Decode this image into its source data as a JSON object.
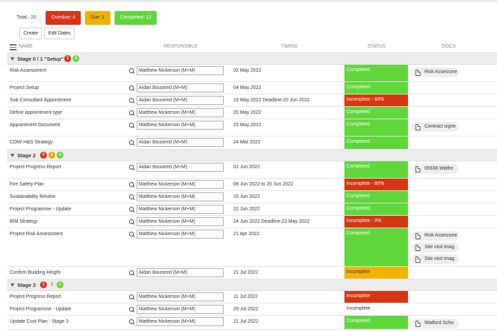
{
  "summary": {
    "total": "Total.: 20",
    "overdue": "Overdue: 4",
    "due": "Due: 1",
    "completed": "Completed: 12"
  },
  "actions": {
    "create": "Create",
    "edit_dates": "Edit Dates"
  },
  "columns": {
    "name": "NAME",
    "responsible": "RESPONSIBLE",
    "timing": "TIMING",
    "status": "STATUS",
    "docs": "DOCS"
  },
  "stages": [
    {
      "label": "Stage 0 / 1 \"Setup\"",
      "badges": [
        "1",
        "5"
      ]
    },
    {
      "label": "Stage 2",
      "badges": [
        "2",
        "1",
        "4"
      ]
    },
    {
      "label": "Stage 3",
      "badges": [
        "1",
        "1",
        "1"
      ]
    }
  ],
  "rows": [
    {
      "name": "Risk Assessment",
      "responsible": "Matthew Nickerson (M+M)",
      "timing": "02 May 2022",
      "status": "Completed",
      "docs": [
        "Risk Assessme"
      ]
    },
    {
      "name": "Project Setup",
      "responsible": "Aidan Boustred (M+M)",
      "timing": "04 May 2022",
      "status": "Completed",
      "docs": []
    },
    {
      "name": "Sub Consultant Appointment",
      "responsible": "Aidan Boustred (M+M)",
      "timing": "19 May 2022 Deadline:20 Jun 2022",
      "status": "Incomplete - 60%",
      "docs": []
    },
    {
      "name": "Define appointment type",
      "responsible": "Matthew Nickerson (M+M)",
      "timing": "20 May 2022",
      "status": "Completed",
      "docs": []
    },
    {
      "name": "Appointment Document",
      "responsible": "Matthew Nickerson (M+M)",
      "timing": "23 May 2022",
      "status": "Completed",
      "docs": [
        "Contract signe"
      ]
    },
    {
      "name": "CDM/ H&S Strategy",
      "responsible": "Aidan Boustred (M+M)",
      "timing": "24 Mar 2022",
      "status": "Completed",
      "docs": []
    },
    {
      "name": "Project Progress Report",
      "responsible": "Aidan Boustred (M+M)",
      "timing": "01 Jun 2022",
      "status": "Completed",
      "docs": [
        "05936 Watfor"
      ]
    },
    {
      "name": "Fire Safety Plan",
      "responsible": "Matthew Nickerson (M+M)",
      "timing": "08 Jun 2022 to 20 Jun 2022",
      "status": "Incomplete - 80%",
      "docs": []
    },
    {
      "name": "Sustainability Review",
      "responsible": "Matthew Nickerson (M+M)",
      "timing": "15 Jun 2022",
      "status": "Completed",
      "docs": []
    },
    {
      "name": "Project Programme - Update",
      "responsible": "Matthew Nickerson (M+M)",
      "timing": "22 Jun 2022",
      "status": "Completed",
      "docs": []
    },
    {
      "name": "BIM Strategy",
      "responsible": "Matthew Nickerson (M+M)",
      "timing": "24 Jun 2022 Deadline:23 May 2022",
      "status": "Incomplete - 0%",
      "docs": []
    },
    {
      "name": "Project Risk Assessment",
      "responsible": "Matthew Nickerson (M+M)",
      "timing": "21 Apr 2022",
      "status": "Completed",
      "docs": [
        "Risk Assessme",
        "Site visit imag",
        "Site visit imag"
      ]
    },
    {
      "name": "Confirm Building Height",
      "responsible": "Aidan Boustred (M+M)",
      "timing": "21 Jul 2022",
      "status": "Incomplete",
      "docs": []
    },
    {
      "name": "Project Progress Report",
      "responsible": "Matthew Nickerson (M+M)",
      "timing": "11 Jul 2022",
      "status": "Incomplete",
      "docs": []
    },
    {
      "name": "Project Programme - Update",
      "responsible": "Matthew Nickerson (M+M)",
      "timing": "29 Jul 2022",
      "status": "Incomplete",
      "docs": []
    },
    {
      "name": "Update Cost Plan - Stage 3",
      "responsible": "Matthew Nickerson (M+M)",
      "timing": "21 Jul 2022",
      "status": "Completed",
      "docs": [
        "Watford Scho"
      ]
    }
  ]
}
